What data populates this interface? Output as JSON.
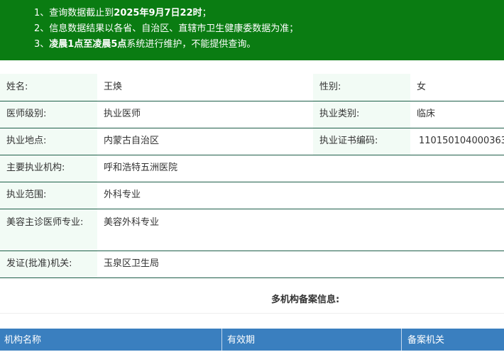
{
  "notice": {
    "line1_prefix": "1、查询数据截止到",
    "line1_bold": "2025年9月7日22时",
    "line1_suffix": "；",
    "line2": "2、信息数据结果以各省、自治区、直辖市卫生健康委数据为准；",
    "line3_prefix": "3、",
    "line3_bold": "凌晨1点至凌晨5点",
    "line3_suffix": "系统进行维护，不能提供查询。",
    "background_color": "#0a7c12"
  },
  "doctor": {
    "name_label": "姓名:",
    "name": "王焕",
    "gender_label": "性别:",
    "gender": "女",
    "level_label": "医师级别:",
    "level": "执业医师",
    "category_label": "执业类别:",
    "category": "临床",
    "location_label": "执业地点:",
    "location": "内蒙古自治区",
    "cert_label": "执业证书编码:",
    "cert_no": "110150104000363",
    "institution_label": "主要执业机构:",
    "institution": "呼和浩特五洲医院",
    "scope_label": "执业范围:",
    "scope": "外科专业",
    "cosmetic_label": "美容主诊医师专业:",
    "cosmetic": "美容外科专业",
    "issuer_label": "发证(批准)机关:",
    "issuer": "玉泉区卫生局"
  },
  "multi_org": {
    "title": "多机构备案信息:",
    "columns": [
      "机构名称",
      "有效期",
      "备案机关"
    ],
    "header_color": "#3a7fbf"
  }
}
